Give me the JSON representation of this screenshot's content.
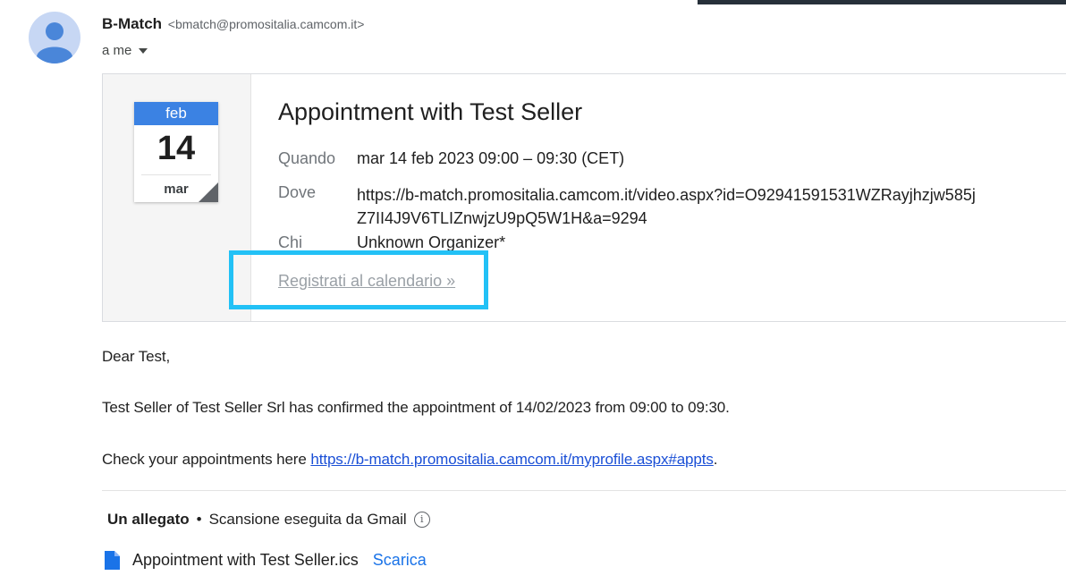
{
  "sender": {
    "name": "B-Match",
    "email": "<bmatch@promositalia.camcom.it>",
    "recipient": "a me"
  },
  "invite": {
    "calendar": {
      "month": "feb",
      "day": "14",
      "weekday": "mar"
    },
    "title": "Appointment with Test Seller",
    "when_label": "Quando",
    "when_value": "mar 14 feb 2023 09:00 – 09:30 (CET)",
    "where_label": "Dove",
    "where_line1": "https://b-match.promositalia.camcom.it/video.aspx?id=O92941591531WZRayjhzjw585j",
    "where_line2": "Z7II4J9V6TLIZnwjzU9pQ5W1H&a=9294",
    "who_label": "Chi",
    "who_value": "Unknown Organizer*",
    "register_link": "Registrati al calendario »"
  },
  "message": {
    "greeting": "Dear Test,",
    "confirmation": "Test Seller of Test Seller Srl has confirmed the appointment of 14/02/2023 from 09:00 to 09:30.",
    "check_prefix": "Check your appointments here ",
    "check_link": "https://b-match.promositalia.camcom.it/myprofile.aspx#appts",
    "check_suffix": "."
  },
  "attachments": {
    "count_label": "Un allegato",
    "separator": "•",
    "scan_label": "Scansione eseguita da Gmail",
    "file_name": "Appointment with Test Seller.ics",
    "download_label": "Scarica"
  },
  "colors": {
    "highlight": "#22c1f6",
    "calendar_header": "#3b82e3",
    "link": "#1a4fd6"
  }
}
